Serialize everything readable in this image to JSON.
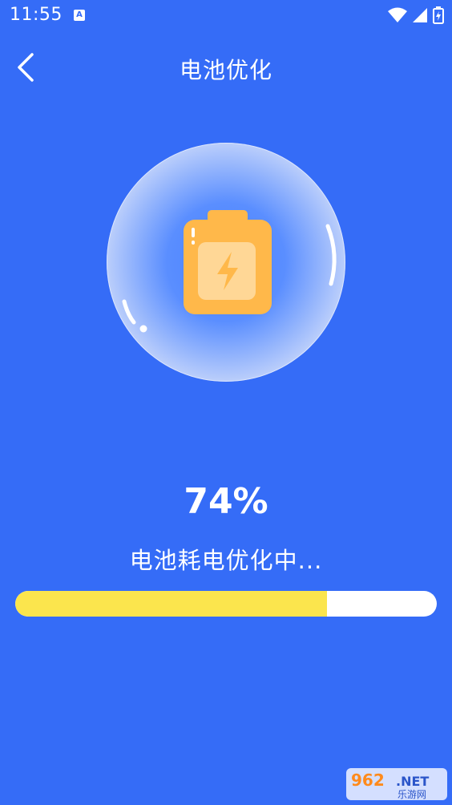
{
  "status_bar": {
    "time": "11:55",
    "keyboard_badge": "A"
  },
  "header": {
    "title": "电池优化"
  },
  "optimizer": {
    "percent_text": "74%",
    "progress": 0.74,
    "status_text": "电池耗电优化中..."
  },
  "watermark": {
    "brand": "962",
    "suffix": ".NET",
    "tagline": "乐游网"
  },
  "colors": {
    "background": "#356cf7",
    "progress_fill": "#fbe54d",
    "battery": "#ffb84a"
  }
}
